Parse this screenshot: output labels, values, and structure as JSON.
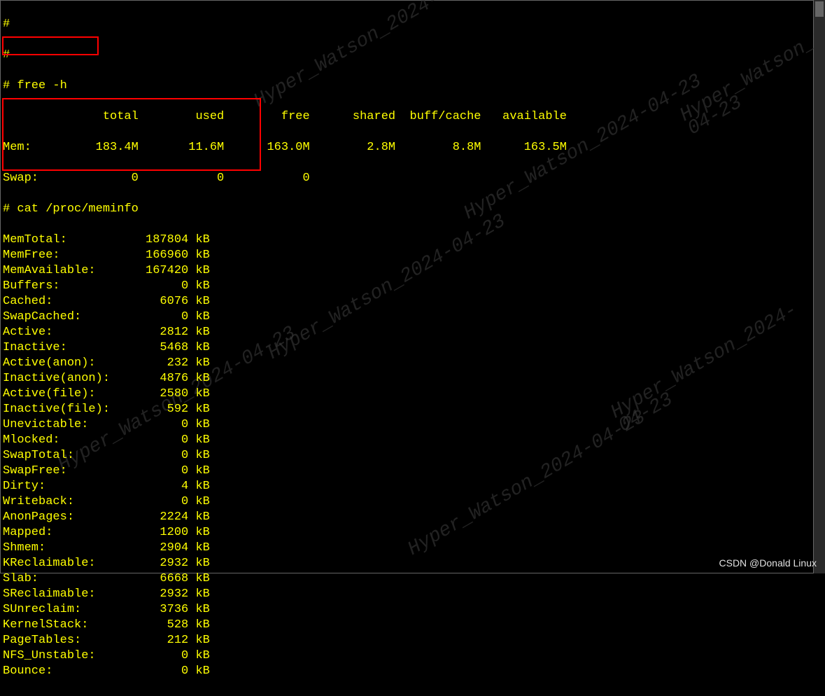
{
  "watermark_text": "Hyper_Watson_2024-04-23",
  "csdn_text": "CSDN @Donald Linux",
  "prompt_lines": [
    "#",
    "#"
  ],
  "cmd1": "# free -h",
  "free_header": "              total        used        free      shared  buff/cache   available",
  "free_rows": [
    "Mem:         183.4M       11.6M      163.0M        2.8M        8.8M      163.5M",
    "Swap:             0           0           0"
  ],
  "cmd2": "# cat /proc/meminfo",
  "meminfo": [
    {
      "label": "MemTotal:",
      "value": "187804",
      "unit": "kB"
    },
    {
      "label": "MemFree:",
      "value": "166960",
      "unit": "kB"
    },
    {
      "label": "MemAvailable:",
      "value": "167420",
      "unit": "kB"
    },
    {
      "label": "Buffers:",
      "value": "0",
      "unit": "kB"
    },
    {
      "label": "Cached:",
      "value": "6076",
      "unit": "kB"
    },
    {
      "label": "SwapCached:",
      "value": "0",
      "unit": "kB"
    },
    {
      "label": "Active:",
      "value": "2812",
      "unit": "kB"
    },
    {
      "label": "Inactive:",
      "value": "5468",
      "unit": "kB"
    },
    {
      "label": "Active(anon):",
      "value": "232",
      "unit": "kB"
    },
    {
      "label": "Inactive(anon):",
      "value": "4876",
      "unit": "kB"
    },
    {
      "label": "Active(file):",
      "value": "2580",
      "unit": "kB"
    },
    {
      "label": "Inactive(file):",
      "value": "592",
      "unit": "kB"
    },
    {
      "label": "Unevictable:",
      "value": "0",
      "unit": "kB"
    },
    {
      "label": "Mlocked:",
      "value": "0",
      "unit": "kB"
    },
    {
      "label": "SwapTotal:",
      "value": "0",
      "unit": "kB"
    },
    {
      "label": "SwapFree:",
      "value": "0",
      "unit": "kB"
    },
    {
      "label": "Dirty:",
      "value": "4",
      "unit": "kB"
    },
    {
      "label": "Writeback:",
      "value": "0",
      "unit": "kB"
    },
    {
      "label": "AnonPages:",
      "value": "2224",
      "unit": "kB"
    },
    {
      "label": "Mapped:",
      "value": "1200",
      "unit": "kB"
    },
    {
      "label": "Shmem:",
      "value": "2904",
      "unit": "kB"
    },
    {
      "label": "KReclaimable:",
      "value": "2932",
      "unit": "kB"
    },
    {
      "label": "Slab:",
      "value": "6668",
      "unit": "kB"
    },
    {
      "label": "SReclaimable:",
      "value": "2932",
      "unit": "kB"
    },
    {
      "label": "SUnreclaim:",
      "value": "3736",
      "unit": "kB"
    },
    {
      "label": "KernelStack:",
      "value": "528",
      "unit": "kB"
    },
    {
      "label": "PageTables:",
      "value": "212",
      "unit": "kB"
    },
    {
      "label": "NFS_Unstable:",
      "value": "0",
      "unit": "kB"
    },
    {
      "label": "Bounce:",
      "value": "0",
      "unit": "kB"
    }
  ]
}
